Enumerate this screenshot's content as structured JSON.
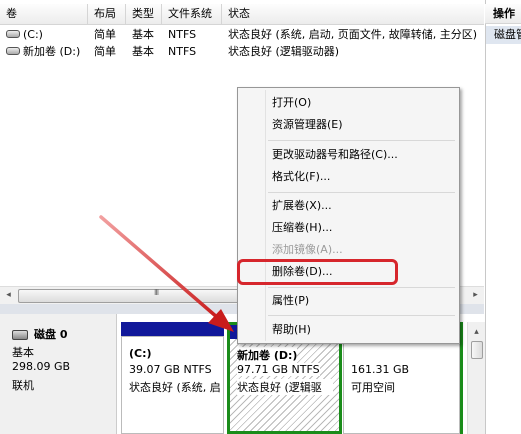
{
  "volume_list": {
    "columns": [
      "卷",
      "布局",
      "类型",
      "文件系统",
      "状态"
    ],
    "rows": [
      {
        "volume": "(C:)",
        "layout": "简单",
        "type": "基本",
        "fs": "NTFS",
        "status": "状态良好 (系统, 启动, 页面文件, 故障转储, 主分区)"
      },
      {
        "volume": "新加卷 (D:)",
        "layout": "简单",
        "type": "基本",
        "fs": "NTFS",
        "status": "状态良好 (逻辑驱动器)"
      }
    ]
  },
  "scroll": {
    "left": "◂",
    "right": "▸",
    "grip": "III",
    "up": "▴"
  },
  "disk": {
    "name": "磁盘 0",
    "type": "基本",
    "size": "298.09 GB",
    "state": "联机",
    "partitions": [
      {
        "name": "(C:)",
        "size": "39.07 GB NTFS",
        "status": "状态良好 (系统, 启"
      },
      {
        "name": "新加卷 (D:)",
        "size": "97.71 GB NTFS",
        "status": "状态良好 (逻辑驱"
      },
      {
        "name": "",
        "size": "161.31 GB",
        "status": "可用空间"
      }
    ]
  },
  "right_panel": {
    "header": "操作",
    "item": "磁盘管理"
  },
  "context_menu": {
    "items": [
      {
        "label": "打开(O)",
        "enabled": true
      },
      {
        "label": "资源管理器(E)",
        "enabled": true
      },
      {
        "label": "更改驱动器号和路径(C)...",
        "enabled": true
      },
      {
        "label": "格式化(F)...",
        "enabled": true
      },
      {
        "label": "扩展卷(X)...",
        "enabled": true
      },
      {
        "label": "压缩卷(H)...",
        "enabled": true
      },
      {
        "label": "添加镜像(A)...",
        "enabled": false
      },
      {
        "label": "删除卷(D)...",
        "enabled": true
      },
      {
        "label": "属性(P)",
        "enabled": true
      },
      {
        "label": "帮助(H)",
        "enabled": true
      }
    ]
  },
  "colors": {
    "partition_bar": "#11189a",
    "selection_outline": "#1a8c1a",
    "annotation_red": "#d6262c"
  }
}
